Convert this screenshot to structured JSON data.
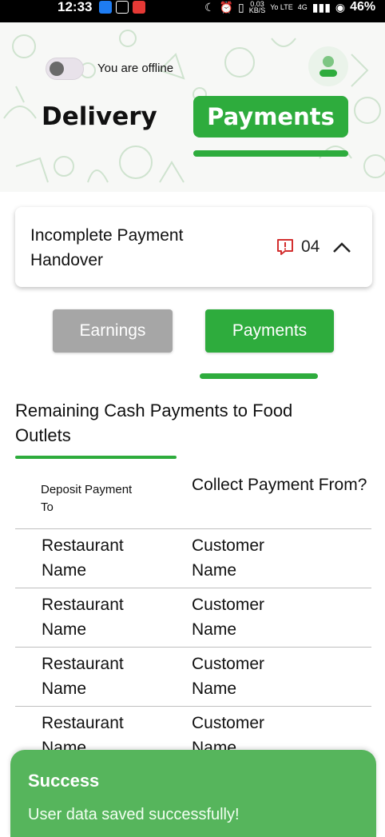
{
  "status_bar": {
    "time": "12:33",
    "network_speed_value": "0.03",
    "network_speed_unit": "KB/S",
    "signal_label": "Yo LTE",
    "network_type": "4G",
    "battery": "46%"
  },
  "header": {
    "offline_label": "You are offline",
    "tab_delivery": "Delivery",
    "tab_payments": "Payments"
  },
  "handover_card": {
    "title": "Incomplete Payment Handover",
    "count": "04"
  },
  "subtabs": {
    "earnings": "Earnings",
    "payments": "Payments"
  },
  "section": {
    "title": "Remaining Cash Payments to Food Outlets"
  },
  "table": {
    "headers": [
      "Deposit Payment To",
      "Collect Payment From?"
    ],
    "rows": [
      [
        "Restaurant Name",
        "Customer Name"
      ],
      [
        "Restaurant Name",
        "Customer Name"
      ],
      [
        "Restaurant Name",
        "Customer Name"
      ],
      [
        "Restaurant Name",
        "Customer Name"
      ]
    ]
  },
  "toast": {
    "title": "Success",
    "message": "User data saved successfully!"
  },
  "colors": {
    "accent": "#2eac3d",
    "toast": "#56b55c",
    "disabled": "#a6a6a6",
    "alert": "#d32f2f"
  }
}
